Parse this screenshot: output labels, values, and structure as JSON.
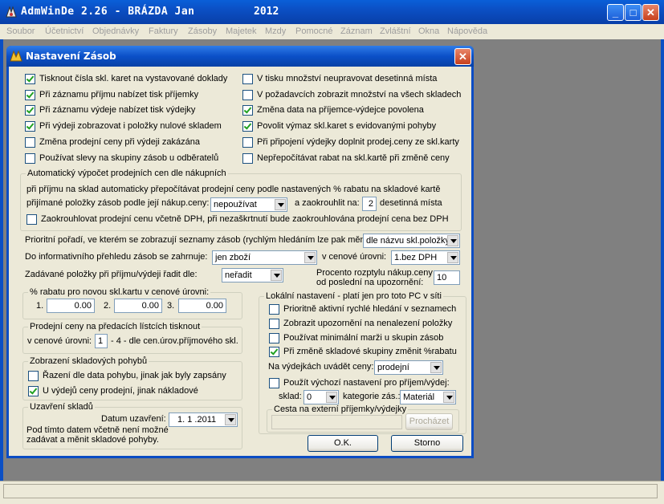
{
  "app": {
    "title": "AdmWinDe 2.26 - BRÁZDA Jan",
    "year": "2012",
    "btn_minimize": "_",
    "btn_maximize": "□",
    "btn_close": "✕"
  },
  "menu": [
    "Soubor",
    "Účetnictví",
    "Objednávky",
    "Faktury",
    "Zásoby",
    "Majetek",
    "Mzdy",
    "Pomocné",
    "Záznam",
    "Zvláštní",
    "Okna",
    "Nápověda"
  ],
  "dialog": {
    "title": "Nastavení Zásob",
    "close_label": "✕",
    "left_checks": [
      {
        "label": "Tisknout čísla skl. karet na vystavované doklady",
        "checked": true
      },
      {
        "label": "Při záznamu příjmu nabízet tisk příjemky",
        "checked": true
      },
      {
        "label": "Při záznamu výdeje nabízet tisk výdejky",
        "checked": true
      },
      {
        "label": "Při výdeji zobrazovat i položky nulové skladem",
        "checked": true
      },
      {
        "label": "Změna prodejní ceny při výdeji zakázána",
        "checked": false
      },
      {
        "label": "Používat slevy na skupiny zásob u odběratelů",
        "checked": false
      }
    ],
    "right_checks": [
      {
        "label": "V tisku množství neupravovat desetinná místa",
        "checked": false
      },
      {
        "label": "V požadavcích zobrazit množství na všech skladech",
        "checked": false
      },
      {
        "label": "Změna data na příjemce-výdejce povolena",
        "checked": true
      },
      {
        "label": "Povolit výmaz skl.karet s evidovanými pohyby",
        "checked": true
      },
      {
        "label": "Při připojení výdejky doplnit prodej.ceny ze skl.karty",
        "checked": false
      },
      {
        "label": "Nepřepočítávat rabat na skl.kartě při změně ceny",
        "checked": false
      }
    ],
    "auto": {
      "caption": "Automatický výpočet prodejních cen dle nákupních",
      "line1": "při příjmu na sklad automaticky přepočítávat prodejní ceny podle nastavených % rabatu na skladové kartě",
      "line2": "přijímané položky zásob podle její nákup.ceny:",
      "combo": "nepoužívat",
      "round_label": "a zaokrouhlit na:",
      "round_value": "2",
      "decimals_label": "desetinná místa",
      "vat_check": {
        "label": "Zaokrouhlovat prodejní cenu včetně DPH, při nezaškrtnutí bude zaokrouhlována prodejní cena bez DPH",
        "checked": false
      }
    },
    "priority": {
      "label": "Prioritní pořadí, ve kterém se zobrazují seznamy zásob (rychlým hledáním lze pak měnit):",
      "combo": "dle názvu skl.položky"
    },
    "overview": {
      "label": "Do informativního přehledu zásob se zahrnuje:",
      "combo": "jen zboží",
      "price_level_label": "v cenové úrovni:",
      "price_level": "1.bez DPH"
    },
    "sort": {
      "label": "Zadávané položky při příjmu/výdeji řadit dle:",
      "combo": "neřadit"
    },
    "spread": {
      "label1": "Procento rozptylu nákup.ceny",
      "label2": "od poslední na upozornění:",
      "value": "10"
    },
    "rabat": {
      "caption": "% rabatu pro novou skl.kartu v cenové úrovni:",
      "labels": [
        "1.",
        "2.",
        "3."
      ],
      "values": [
        "0.00",
        "0.00",
        "0.00"
      ]
    },
    "tickets": {
      "caption": "Prodejní ceny na předacích lístcích tisknout",
      "label_before": "v cenové úrovni:",
      "value": "1",
      "label_after": "- 4 - dle cen.úrov.příjmového skl."
    },
    "movements": {
      "caption": "Zobrazení skladových pohybů",
      "checks": [
        {
          "label": "Řazení dle data pohybu, jinak jak byly zapsány",
          "checked": false
        },
        {
          "label": "U výdejů ceny prodejní, jinak nákladové",
          "checked": true
        }
      ]
    },
    "closing": {
      "caption": "Uzavření skladů",
      "date_label": "Datum uzavření:",
      "date_value": "1. 1 .2011",
      "note1": "Pod tímto datem včetně není možné",
      "note2": "zadávat a měnit skladové pohyby."
    },
    "local": {
      "caption": "Lokální nastavení - platí jen pro toto PC v síti",
      "checks": [
        {
          "label": "Prioritně aktivní rychlé hledání v seznamech",
          "checked": false
        },
        {
          "label": "Zobrazit upozornění na nenalezení položky",
          "checked": false
        },
        {
          "label": "Používat minimální marži u skupin zásob",
          "checked": false
        },
        {
          "label": "Při změně skladové skupiny změnit %rabatu",
          "checked": true
        }
      ],
      "issue_price_label": "Na výdejkách uvádět ceny:",
      "issue_price": "prodejní",
      "default_check": {
        "label": "Použít výchozí nastavení pro příjem/výdej:",
        "checked": false
      },
      "store_label": "sklad:",
      "store_value": "0",
      "category_label": "kategorie zás.:",
      "category_value": "Materiál",
      "path_caption": "Cesta na externí příjemky/výdejky",
      "path_value": "",
      "browse_label": "Procházet"
    },
    "ok_label": "O.K.",
    "cancel_label": "Storno"
  }
}
